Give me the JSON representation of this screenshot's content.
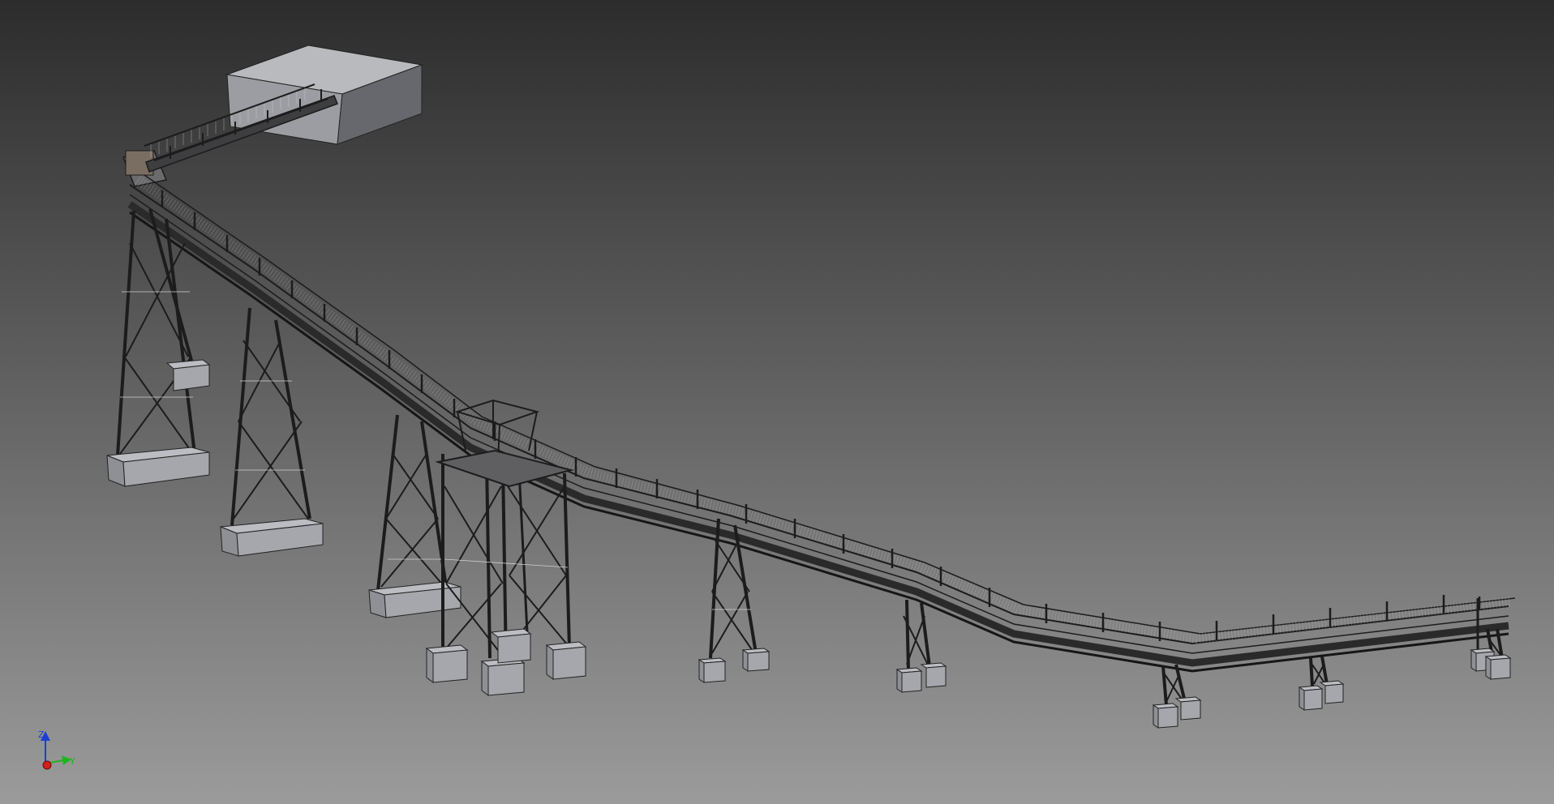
{
  "viewport": {
    "background_top": "#2c2c2c",
    "background_bottom": "#9b9b9b"
  },
  "axis_triad": {
    "z_label": "Z",
    "x_label": "Y",
    "z_color": "#1e3fd0",
    "y_color": "#1fb41f",
    "x_color": "#d21e1e"
  },
  "model": {
    "steel_color": "#1c1c1c",
    "concrete_color": "#8f9096",
    "concrete_top_color": "#b4b5ba",
    "building_color": "#a1a2a7"
  }
}
